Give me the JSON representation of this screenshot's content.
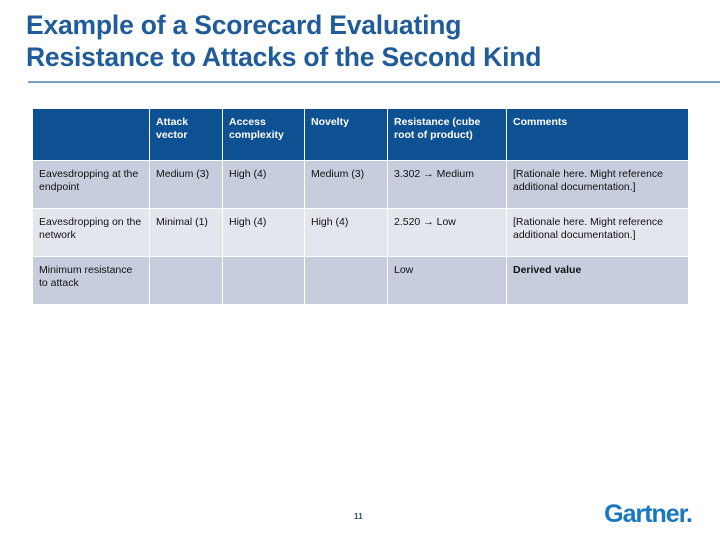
{
  "slide": {
    "title": "Example of a Scorecard Evaluating\nResistance to Attacks of the Second Kind",
    "title_color": "#1f5c99",
    "rule_color": "#7e9dc2"
  },
  "table": {
    "header_bg": "#0d5193",
    "header_text_color": "#ffffff",
    "row_shade_bg": "#c6cddc",
    "row_light_bg": "#e3e6ed",
    "headers": [
      "",
      "Attack vector",
      "Access complexity",
      "Novelty",
      "Resistance (cube root of product)",
      "Comments"
    ],
    "rows": [
      {
        "label": "Eavesdropping at the endpoint",
        "attack_vector": "Medium (3)",
        "access_complexity": "High (4)",
        "novelty": "Medium (3)",
        "resistance": "3.302 → Medium",
        "comments": "[Rationale here. Might reference additional documentation.]"
      },
      {
        "label": "Eavesdropping on the network",
        "attack_vector": "Minimal (1)",
        "access_complexity": "High (4)",
        "novelty": "High (4)",
        "resistance": "2.520 → Low",
        "comments": "[Rationale here. Might reference additional documentation.]"
      },
      {
        "label": "Minimum resistance to attack",
        "attack_vector": "",
        "access_complexity": "",
        "novelty": "",
        "resistance": "Low",
        "comments": "Derived value"
      }
    ]
  },
  "footer": {
    "page_number": "11",
    "logo_text": "Gartner.",
    "logo_color": "#1778bd"
  }
}
